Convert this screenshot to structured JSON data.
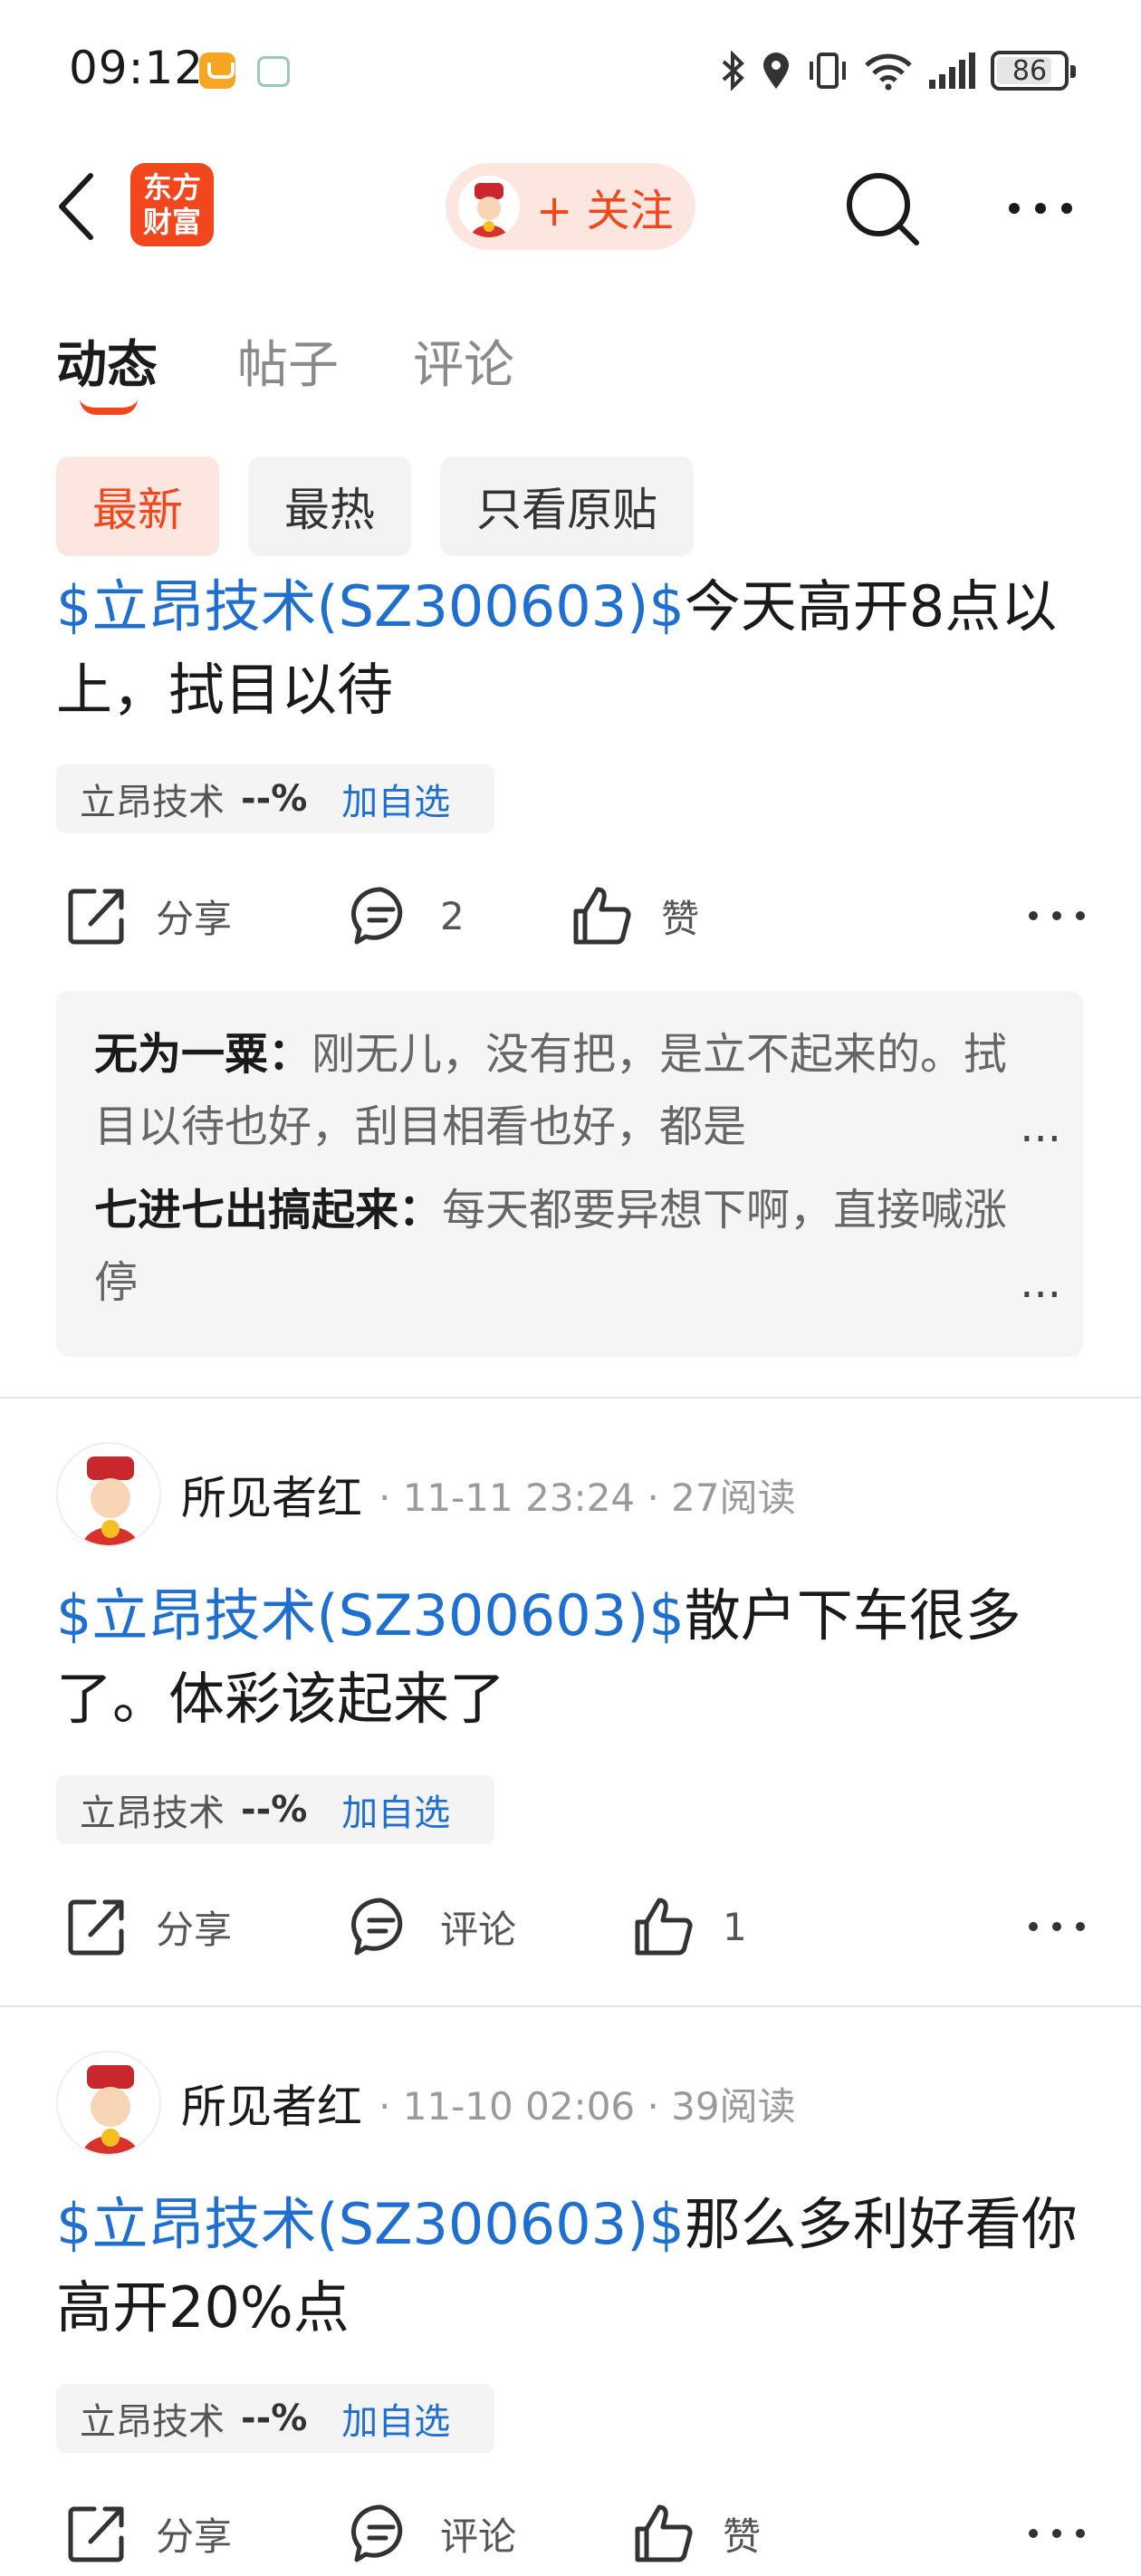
{
  "status_bar": {
    "time": "09:12",
    "battery": "86"
  },
  "header": {
    "logo_line1": "东方",
    "logo_line2": "财富",
    "follow_label": "+ 关注"
  },
  "tabs": [
    {
      "label": "动态"
    },
    {
      "label": "帖子"
    },
    {
      "label": "评论"
    }
  ],
  "filters": [
    {
      "label": "最新"
    },
    {
      "label": "最热"
    },
    {
      "label": "只看原贴"
    }
  ],
  "posts": [
    {
      "stock_link": "$立昂技术(SZ300603)$",
      "text": "今天高开8点以上，拭目以待",
      "tag": {
        "name": "立昂技术",
        "change": "--%",
        "add": "加自选"
      },
      "actions": {
        "share": "分享",
        "comment": "2",
        "like": "赞"
      },
      "comments": [
        {
          "author": "无为一粟：",
          "text": "刚无儿，没有把，是立不起来的。拭目以待也好，刮目相看也好，都是",
          "ellipsis": "..."
        },
        {
          "author": "七进七出搞起来：",
          "text": "每天都要异想下啊，直接喊涨停",
          "ellipsis": "..."
        }
      ]
    },
    {
      "author": "所见者红",
      "meta": "· 11-11 23:24 · 27阅读",
      "stock_link": "$立昂技术(SZ300603)$",
      "text": "散户下车很多了。体彩该起来了",
      "tag": {
        "name": "立昂技术",
        "change": "--%",
        "add": "加自选"
      },
      "actions": {
        "share": "分享",
        "comment": "评论",
        "like": "1"
      }
    },
    {
      "author": "所见者红",
      "meta": "· 11-10 02:06 · 39阅读",
      "stock_link": "$立昂技术(SZ300603)$",
      "text": "那么多利好看你高开20%点",
      "tag": {
        "name": "立昂技术",
        "change": "--%",
        "add": "加自选"
      },
      "actions": {
        "share": "分享",
        "comment": "评论",
        "like": "赞"
      }
    }
  ],
  "colors": {
    "accent": "#f2461d",
    "link": "#1f6fd1",
    "chip_active_bg": "#fde6df"
  }
}
